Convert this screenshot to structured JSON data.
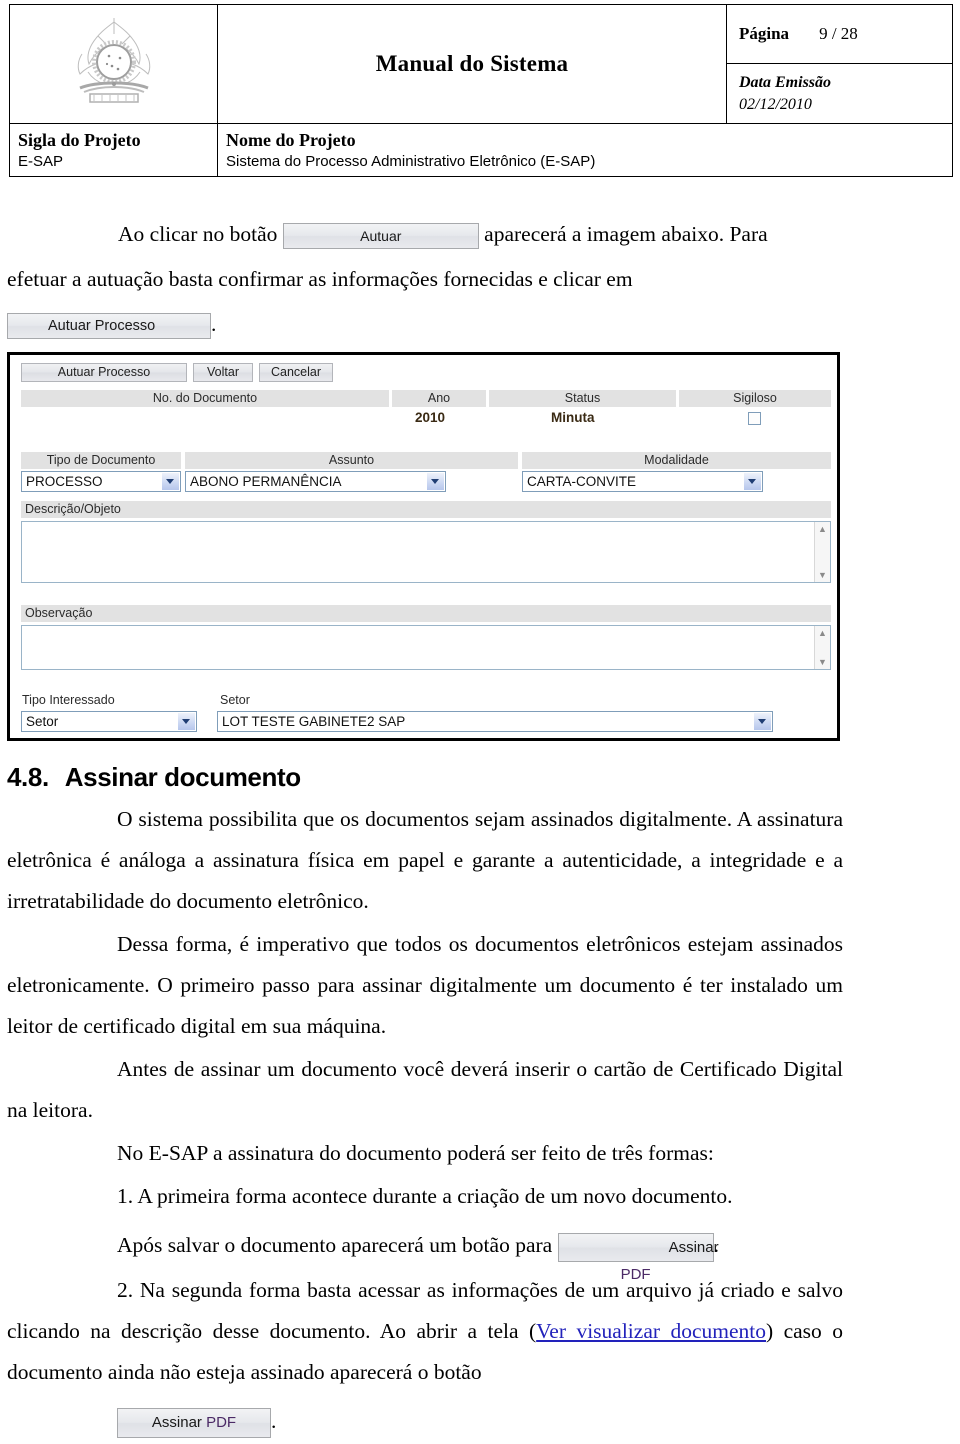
{
  "header": {
    "logo_alt": "brazil-coat-of-arms",
    "document_title": "Manual do Sistema",
    "page_label": "Página",
    "page_value": "9 / 28",
    "date_label": "Data Emissão",
    "date_value": "02/12/2010",
    "sigla_label": "Sigla do Projeto",
    "sigla_value": "E-SAP",
    "nome_label": "Nome do Projeto",
    "nome_value": "Sistema do Processo Administrativo Eletrônico (E-SAP)"
  },
  "intro": {
    "part1": "Ao clicar no botão",
    "button_autuar": "Autuar",
    "part2": "aparecerá a imagem abaixo. Para",
    "line2": "efetuar a autuação basta confirmar as informações fornecidas e clicar em",
    "button_autuar_processo": "Autuar Processo",
    "period": "."
  },
  "app_screenshot": {
    "toolbar": {
      "autuar_processo": "Autuar Processo",
      "voltar": "Voltar",
      "cancelar": "Cancelar"
    },
    "columns": {
      "no_documento": "No. do Documento",
      "ano": "Ano",
      "status": "Status",
      "sigiloso": "Sigiloso"
    },
    "values": {
      "no_documento": "",
      "ano": "2010",
      "status": "Minuta",
      "sigiloso_checked": false
    },
    "fields": {
      "tipo_documento_label": "Tipo de Documento",
      "tipo_documento_value": "PROCESSO",
      "assunto_label": "Assunto",
      "assunto_value": "ABONO PERMANÊNCIA",
      "modalidade_label": "Modalidade",
      "modalidade_value": "CARTA-CONVITE",
      "descricao_label": "Descrição/Objeto",
      "descricao_value": "",
      "observacao_label": "Observação",
      "observacao_value": "",
      "tipo_interessado_label": "Tipo Interessado",
      "tipo_interessado_value": "Setor",
      "setor_label": "Setor",
      "setor_value": "LOT TESTE GABINETE2 SAP"
    },
    "scroll_up_glyph": "▲",
    "scroll_down_glyph": "▼"
  },
  "section": {
    "number": "4.8.",
    "title": "Assinar documento",
    "p1": "O sistema possibilita que os documentos sejam assinados digitalmente. A assinatura eletrônica é análoga a assinatura física em papel e garante a autenticidade, a integridade e a irretratabilidade do documento eletrônico.",
    "p2": "Dessa forma, é imperativo que todos os documentos eletrônicos estejam assinados eletronicamente. O primeiro passo para assinar digitalmente um documento é ter instalado um leitor de certificado digital em sua máquina.",
    "p3": "Antes de assinar um documento você deverá inserir o cartão de Certificado Digital na leitora.",
    "p4": "No E-SAP a assinatura do documento poderá ser feito de três formas:",
    "item1": "1. A primeira forma acontece durante a criação de um novo documento.",
    "item1_after": "Após salvar o documento aparecerá um botão para",
    "btn_assinar_pdf_1_a": "Assinar ",
    "btn_assinar_pdf_1_b": "PDF",
    "item1_period": ".",
    "item2_a": "2.  Na segunda forma basta acessar as informações de um arquivo já criado e salvo clicando na descrição desse documento. Ao abrir a tela (",
    "item2_link": "Ver visualizar documento",
    "item2_b": ") caso o documento ainda não esteja assinado aparecerá o botão",
    "btn_assinar_pdf_2_a": "Assinar ",
    "btn_assinar_pdf_2_b": "PDF",
    "item2_period": "."
  }
}
